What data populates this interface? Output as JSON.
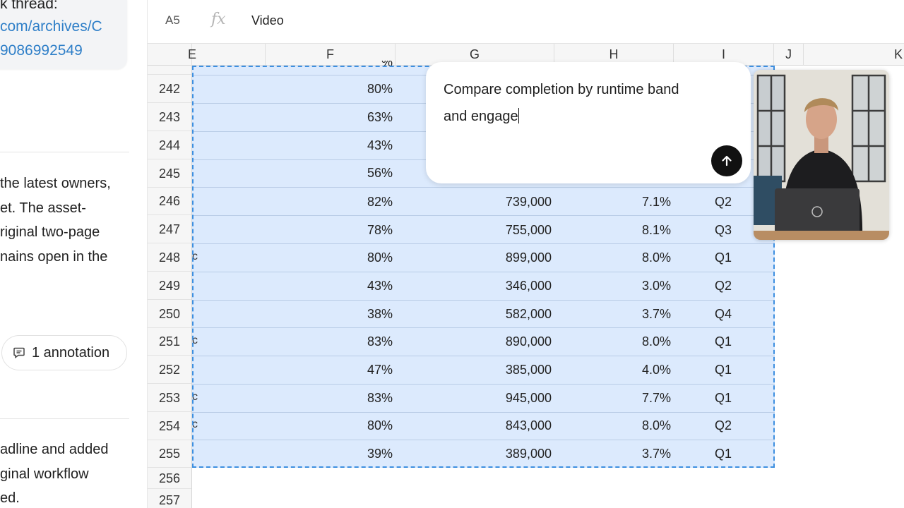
{
  "chat": {
    "link_card": {
      "line1": "k thread:",
      "line2": "com/archives/C",
      "line3": "9086992549"
    },
    "paragraph1": [
      "the latest owners,",
      "et. The asset-",
      "riginal two-page",
      "nains open in the"
    ],
    "annotation_label": "1 annotation",
    "paragraph2": [
      "adline and added",
      "ginal workflow",
      "ed."
    ]
  },
  "formula_bar": {
    "cell_ref": "A5",
    "fx": "fx",
    "value": "Video"
  },
  "columns": [
    "E",
    "F",
    "G",
    "H",
    "I",
    "J",
    "K"
  ],
  "partial_row_value": "%",
  "rows": [
    {
      "num": "242",
      "f": "80%",
      "g": "",
      "h": "",
      "i": "",
      "e_stub": ""
    },
    {
      "num": "243",
      "f": "63%",
      "g": "",
      "h": "",
      "i": "",
      "e_stub": ""
    },
    {
      "num": "244",
      "f": "43%",
      "g": "",
      "h": "",
      "i": "",
      "e_stub": ""
    },
    {
      "num": "245",
      "f": "56%",
      "g": "",
      "h": "",
      "i": "",
      "e_stub": ""
    },
    {
      "num": "246",
      "f": "82%",
      "g": "739,000",
      "h": "7.1%",
      "i": "Q2",
      "e_stub": ""
    },
    {
      "num": "247",
      "f": "78%",
      "g": "755,000",
      "h": "8.1%",
      "i": "Q3",
      "e_stub": ""
    },
    {
      "num": "248",
      "f": "80%",
      "g": "899,000",
      "h": "8.0%",
      "i": "Q1",
      "e_stub": "c"
    },
    {
      "num": "249",
      "f": "43%",
      "g": "346,000",
      "h": "3.0%",
      "i": "Q2",
      "e_stub": ""
    },
    {
      "num": "250",
      "f": "38%",
      "g": "582,000",
      "h": "3.7%",
      "i": "Q4",
      "e_stub": ""
    },
    {
      "num": "251",
      "f": "83%",
      "g": "890,000",
      "h": "8.0%",
      "i": "Q1",
      "e_stub": "c"
    },
    {
      "num": "252",
      "f": "47%",
      "g": "385,000",
      "h": "4.0%",
      "i": "Q1",
      "e_stub": ""
    },
    {
      "num": "253",
      "f": "83%",
      "g": "945,000",
      "h": "7.7%",
      "i": "Q1",
      "e_stub": "c"
    },
    {
      "num": "254",
      "f": "80%",
      "g": "843,000",
      "h": "8.0%",
      "i": "Q2",
      "e_stub": "c"
    },
    {
      "num": "255",
      "f": "39%",
      "g": "389,000",
      "h": "3.7%",
      "i": "Q1",
      "e_stub": ""
    }
  ],
  "empty_rows": [
    "256",
    "257"
  ],
  "prompt": {
    "line1": "Compare completion by runtime band",
    "line2": "and engage"
  },
  "icons": {
    "send": "arrow-up-icon",
    "annotation": "comment-icon",
    "formula": "fx-icon"
  },
  "colors": {
    "selection_fill": "#dceafd",
    "selection_border": "#3d8fe0",
    "link": "#2f7fc8",
    "send_button": "#111111"
  }
}
